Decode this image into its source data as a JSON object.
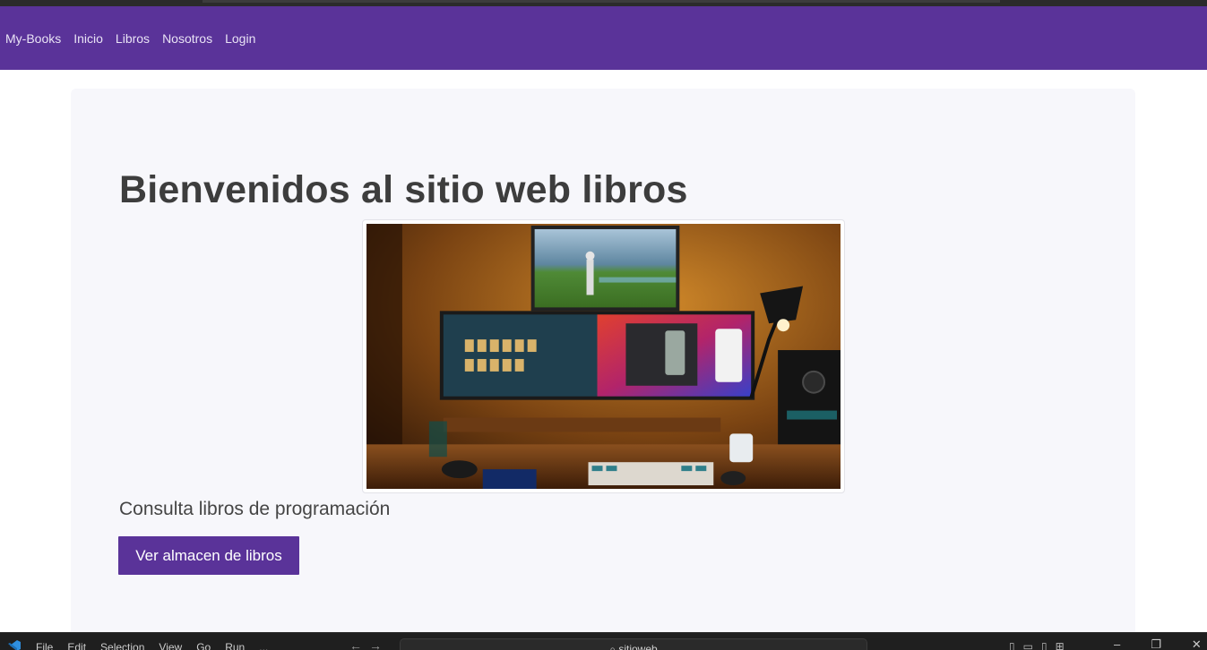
{
  "navbar": {
    "brand": "My-Books",
    "items": [
      "Inicio",
      "Libros",
      "Nosotros",
      "Login"
    ],
    "background": "#5a3399"
  },
  "main": {
    "title": "Bienvenidos al sitio web libros",
    "subtitle": "Consulta libros de programación",
    "button_label": "Ver almacen de libros",
    "image_alt": "desk-setup-photo"
  },
  "taskbar": {
    "menu": [
      "File",
      "Edit",
      "Selection",
      "View",
      "Go",
      "Run",
      "..."
    ],
    "search_text": "sitioweb",
    "window_controls": [
      "minimize",
      "restore",
      "close"
    ]
  },
  "colors": {
    "accent": "#5a3399",
    "jumbotron_bg": "#f7f7fb",
    "text": "#3d3d3d"
  }
}
